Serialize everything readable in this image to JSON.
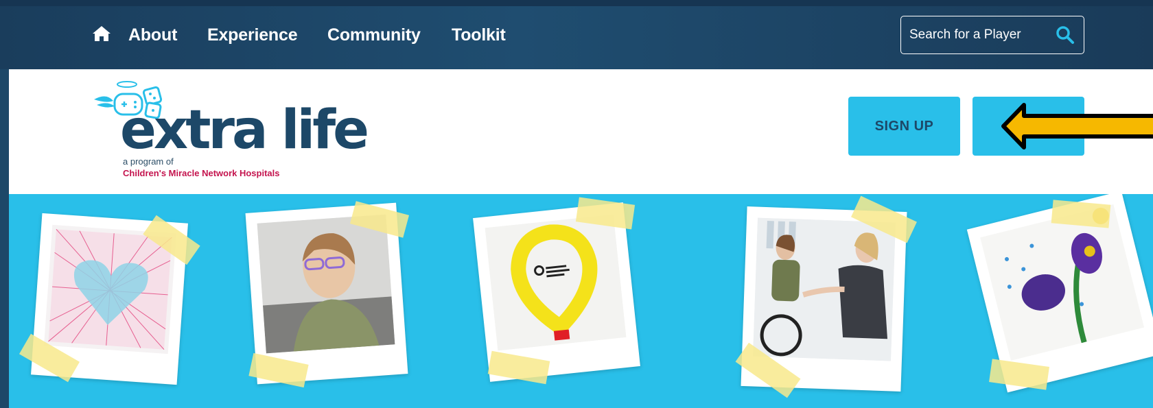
{
  "nav": {
    "items": [
      {
        "label": "About"
      },
      {
        "label": "Experience"
      },
      {
        "label": "Community"
      },
      {
        "label": "Toolkit"
      }
    ],
    "home_icon": "home-icon",
    "search": {
      "placeholder": "Search for a Player",
      "icon": "search-icon"
    }
  },
  "logo": {
    "wordmark": "extra life",
    "tagline": "a program of",
    "org": "Children's Miracle Network Hospitals"
  },
  "header": {
    "signup_label": "SIGN UP",
    "second_button_label": ""
  },
  "photos": [
    {
      "subject": "heart string art"
    },
    {
      "subject": "smiling girl with glasses"
    },
    {
      "subject": "yellow balloon sticky notes"
    },
    {
      "subject": "girl in wheelchair with therapist"
    },
    {
      "subject": "flower painting"
    }
  ],
  "colors": {
    "nav_bg": "#1d4868",
    "accent_blue": "#29bfe9",
    "brand_navy": "#1d4868",
    "brand_red": "#c4144e",
    "arrow_fill": "#f6b800"
  }
}
